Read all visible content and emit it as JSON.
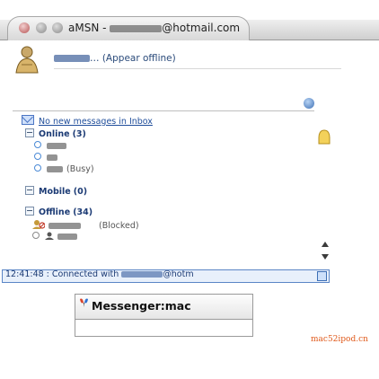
{
  "window": {
    "title": "aMSN - ",
    "title_email_suffix": "@hotmail.com"
  },
  "user": {
    "display_name_suffix": "… (Appear offline)"
  },
  "inbox": {
    "label": "No new messages in Inbox"
  },
  "groups": [
    {
      "label": "Online",
      "count": "(3)"
    },
    {
      "label": "Mobile",
      "count": "(0)"
    },
    {
      "label": "Offline",
      "count": "(34)"
    }
  ],
  "contacts": {
    "online_busy_note": "(Busy)",
    "offline_blocked_note": "(Blocked)"
  },
  "statusbar": {
    "text": "12:41:48 : Connected with ",
    "email_suffix": "@hotm"
  },
  "banner": {
    "logo_text": "Messenger:mac"
  },
  "watermark": {
    "text": "mac52ipod.cn"
  },
  "colors": {
    "link": "#1f4d9a",
    "group": "#1b3a74",
    "watermark": "#e05a1c"
  }
}
